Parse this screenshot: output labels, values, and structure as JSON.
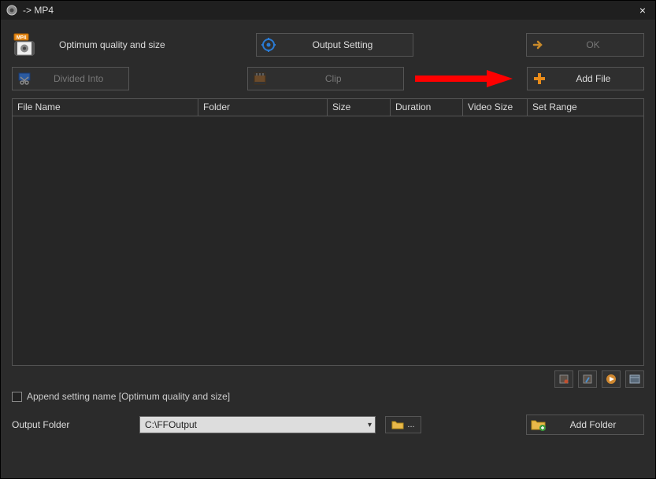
{
  "window": {
    "title": "-> MP4",
    "close": "×"
  },
  "top": {
    "quality_label": "Optimum quality and size",
    "output_setting": "Output Setting",
    "ok": "OK"
  },
  "row2": {
    "divided_into": "Divided Into",
    "clip": "Clip",
    "add_file": "Add File"
  },
  "table": {
    "headers": {
      "file_name": "File Name",
      "folder": "Folder",
      "size": "Size",
      "duration": "Duration",
      "video_size": "Video Size",
      "set_range": "Set Range"
    }
  },
  "append": {
    "label": "Append setting name [Optimum quality and size]"
  },
  "output": {
    "label": "Output Folder",
    "path": "C:\\FFOutput",
    "browse": "...",
    "add_folder": "Add Folder"
  }
}
